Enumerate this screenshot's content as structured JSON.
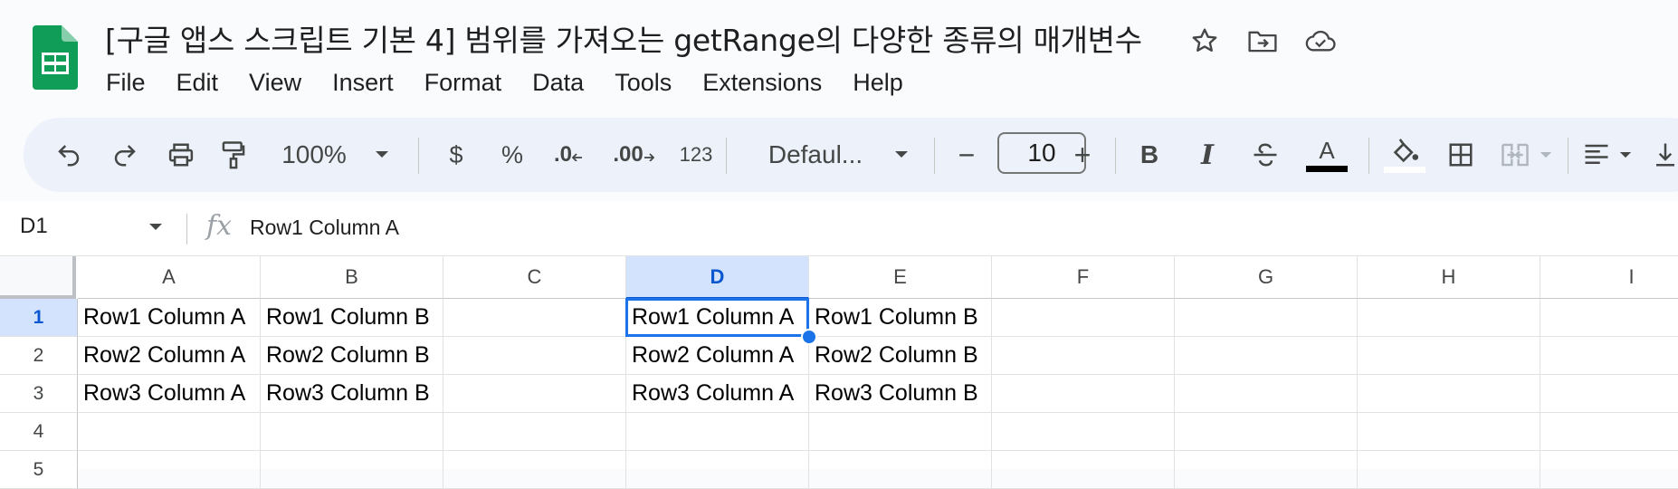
{
  "doc": {
    "title": "[구글 앱스 스크립트 기본 4] 범위를 가져오는 getRange의 다양한 종류의 매개변수"
  },
  "menu": [
    "File",
    "Edit",
    "View",
    "Insert",
    "Format",
    "Data",
    "Tools",
    "Extensions",
    "Help"
  ],
  "toolbar": {
    "zoom": "100%",
    "currency": "$",
    "percent": "%",
    "decrease_decimal": ".0",
    "increase_decimal": ".00",
    "number_format": "123",
    "font": "Defaul...",
    "font_size": "10",
    "minus": "−",
    "plus": "+",
    "bold": "B",
    "italic": "I",
    "text_color_letter": "A"
  },
  "formula_bar": {
    "name_box": "D1",
    "fx": "fx",
    "value": "Row1 Column A"
  },
  "grid": {
    "columns": [
      "A",
      "B",
      "C",
      "D",
      "E",
      "F",
      "G",
      "H",
      "I"
    ],
    "active_column": "D",
    "rows": [
      "1",
      "2",
      "3",
      "4",
      "5"
    ],
    "active_row": "1",
    "cells": [
      [
        "Row1 Column A",
        "Row1 Column B",
        "",
        "Row1 Column A",
        "Row1 Column B",
        "",
        "",
        "",
        ""
      ],
      [
        "Row2 Column A",
        "Row2 Column B",
        "",
        "Row2 Column A",
        "Row2 Column B",
        "",
        "",
        "",
        ""
      ],
      [
        "Row3 Column A",
        "Row3 Column B",
        "",
        "Row3 Column A",
        "Row3 Column B",
        "",
        "",
        "",
        ""
      ],
      [
        "",
        "",
        "",
        "",
        "",
        "",
        "",
        "",
        ""
      ],
      [
        "",
        "",
        "",
        "",
        "",
        "",
        "",
        "",
        ""
      ]
    ]
  },
  "colors": {
    "accent": "#1a73e8",
    "header_active_bg": "#d3e3fd",
    "toolbar_bg": "#edf2fa",
    "sheets_green": "#0f9d58"
  }
}
